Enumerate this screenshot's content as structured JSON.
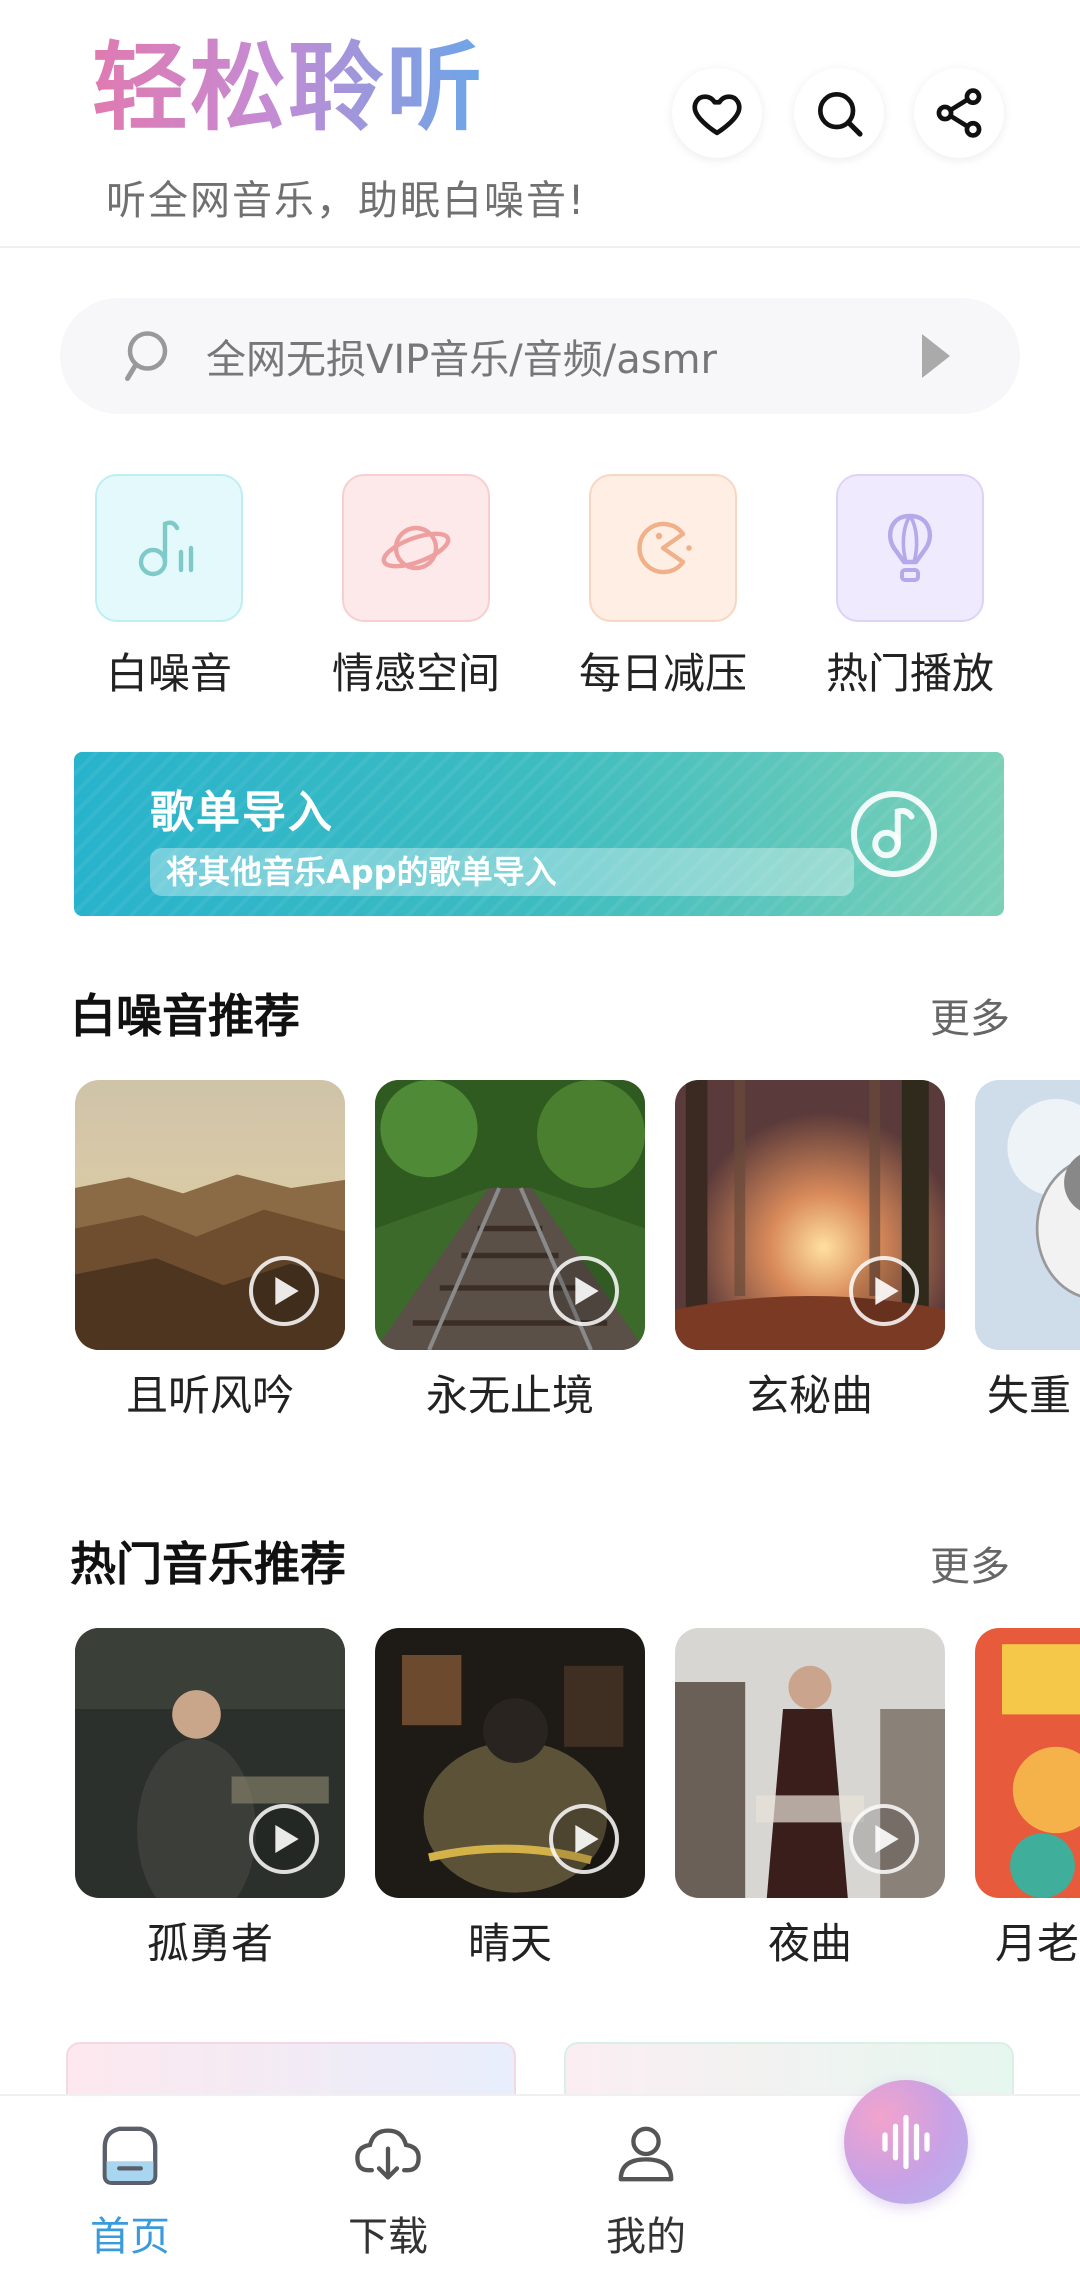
{
  "header": {
    "title": "轻松聆听",
    "subtitle": "听全网音乐，助眠白噪音!",
    "actions": [
      "heart-icon",
      "search-icon",
      "share-icon"
    ]
  },
  "search": {
    "placeholder": "全网无损VIP音乐/音频/asmr"
  },
  "categories": [
    {
      "label": "白噪音",
      "icon": "music-note-icon",
      "color": "#7fd3d4"
    },
    {
      "label": "情感空间",
      "icon": "planet-icon",
      "color": "#f0a7a7"
    },
    {
      "label": "每日减压",
      "icon": "pacman-icon",
      "color": "#f3b38a"
    },
    {
      "label": "热门播放",
      "icon": "hot-air-balloon-icon",
      "color": "#b6a9ea"
    }
  ],
  "banner": {
    "title": "歌单导入",
    "subtitle": "将其他音乐App的歌单导入"
  },
  "white_noise": {
    "title": "白噪音推荐",
    "more": "更多",
    "items": [
      {
        "label": "且听风吟"
      },
      {
        "label": "永无止境"
      },
      {
        "label": "玄秘曲"
      },
      {
        "label": "失重"
      }
    ]
  },
  "hot_music": {
    "title": "热门音乐推荐",
    "more": "更多",
    "items": [
      {
        "label": "孤勇者"
      },
      {
        "label": "晴天"
      },
      {
        "label": "夜曲"
      },
      {
        "label": "月老"
      }
    ]
  },
  "nav": {
    "home": "首页",
    "download": "下载",
    "mine": "我的"
  },
  "colors": {
    "accent": "#3a9bdc",
    "banner_start": "#28b3cc",
    "banner_end": "#7bd0b7"
  }
}
